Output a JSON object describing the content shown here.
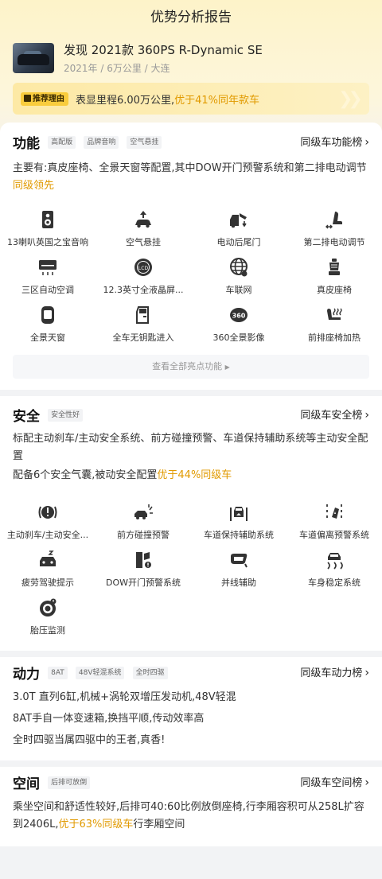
{
  "header": {
    "title": "优势分析报告"
  },
  "car": {
    "title": "发现 2021款 360PS R-Dynamic SE",
    "meta": "2021年 / 6万公里 / 大连"
  },
  "recommend": {
    "tag": "推荐理由",
    "text": "表显里程6.00万公里,",
    "highlight": "优于41%同年款车"
  },
  "function": {
    "title": "功能",
    "chips": [
      "高配版",
      "品牌音响",
      "空气悬挂"
    ],
    "rank": "同级车功能榜",
    "desc_prefix": "主要有:真皮座椅、全景天窗等配置,其中DOW开门预警系统和第二排电动调节",
    "desc_highlight": "同级领先",
    "features": [
      {
        "label": "13喇叭英国之宝音响",
        "icon": "speaker-icon"
      },
      {
        "label": "空气悬挂",
        "icon": "air-suspension-icon"
      },
      {
        "label": "电动后尾门",
        "icon": "tailgate-icon"
      },
      {
        "label": "第二排电动调节",
        "icon": "seat-adjust-icon"
      },
      {
        "label": "三区自动空调",
        "icon": "air-conditioner-icon"
      },
      {
        "label": "12.3英寸全液晶屏...",
        "icon": "lcd-icon"
      },
      {
        "label": "车联网",
        "icon": "globe-icon"
      },
      {
        "label": "真皮座椅",
        "icon": "leather-seat-icon"
      },
      {
        "label": "全景天窗",
        "icon": "sunroof-icon"
      },
      {
        "label": "全车无钥匙进入",
        "icon": "keyless-door-icon"
      },
      {
        "label": "360全景影像",
        "icon": "camera-360-icon"
      },
      {
        "label": "前排座椅加热",
        "icon": "seat-heating-icon"
      }
    ],
    "more": "查看全部亮点功能"
  },
  "safety": {
    "title": "安全",
    "chips": [
      "安全性好"
    ],
    "rank": "同级车安全榜",
    "desc1": "标配主动刹车/主动安全系统、前方碰撞预警、车道保持辅助系统等主动安全配置",
    "desc2_prefix": "配备6个安全气囊,被动安全配置",
    "desc2_highlight": "优于44%同级车",
    "features": [
      {
        "label": "主动刹车/主动安全...",
        "icon": "brake-icon"
      },
      {
        "label": "前方碰撞预警",
        "icon": "collision-warning-icon"
      },
      {
        "label": "车道保持辅助系统",
        "icon": "lane-keep-icon"
      },
      {
        "label": "车道偏离预警系统",
        "icon": "lane-departure-icon"
      },
      {
        "label": "疲劳驾驶提示",
        "icon": "fatigue-icon"
      },
      {
        "label": "DOW开门预警系统",
        "icon": "door-warning-icon"
      },
      {
        "label": "并线辅助",
        "icon": "mirror-icon"
      },
      {
        "label": "车身稳定系统",
        "icon": "stability-icon"
      },
      {
        "label": "胎压监测",
        "icon": "tire-pressure-icon"
      }
    ]
  },
  "power": {
    "title": "动力",
    "chips": [
      "8AT",
      "48V轻混系统",
      "全时四驱"
    ],
    "rank": "同级车动力榜",
    "lines": [
      "3.0T 直列6缸,机械+涡轮双增压发动机,48V轻混",
      "8AT手自一体变速箱,换挡平顺,传动效率高",
      "全时四驱当属四驱中的王者,真香!"
    ]
  },
  "space": {
    "title": "空间",
    "chips": [
      "后排可放倒"
    ],
    "rank": "同级车空间榜",
    "desc_prefix": "乘坐空间和舒适性较好,后排可40:60比例放倒座椅,行李厢容积可从258L扩容到2406L,",
    "desc_highlight": "优于63%同级车",
    "desc_suffix": "行李厢空间"
  },
  "colors": {
    "accent": "#e19a00",
    "tag_bg": "#f9cc3d",
    "top_bg": "#fdf3c9"
  }
}
